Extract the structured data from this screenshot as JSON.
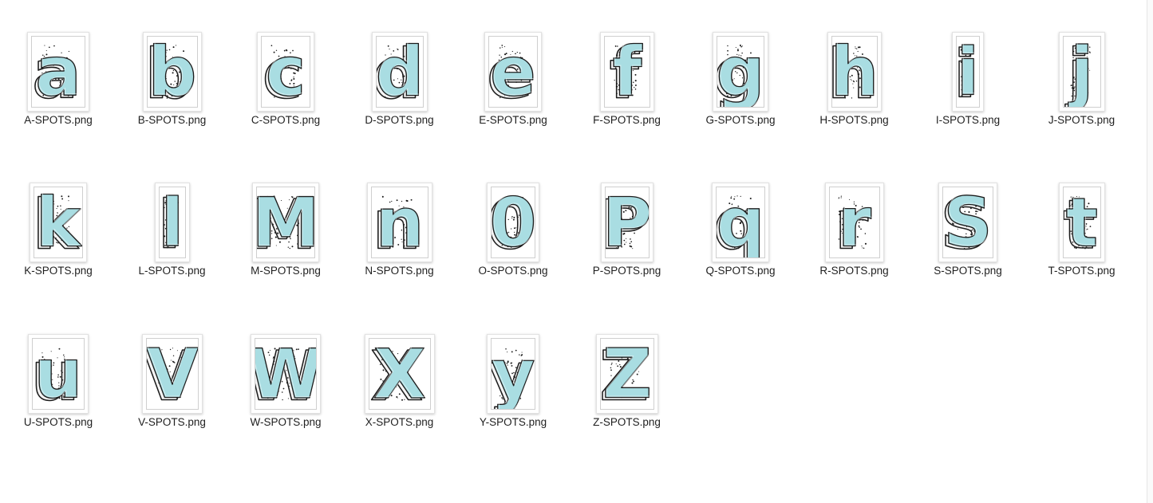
{
  "colors": {
    "letter_fill": "#a9dde2",
    "outline": "#1c1c1c",
    "spots": "#1c1c1c"
  },
  "files": [
    {
      "name": "A-SPOTS.png",
      "glyph": "a",
      "thumb_icon": "letter-a-icon"
    },
    {
      "name": "B-SPOTS.png",
      "glyph": "b",
      "thumb_icon": "letter-b-icon"
    },
    {
      "name": "C-SPOTS.png",
      "glyph": "c",
      "thumb_icon": "letter-c-icon"
    },
    {
      "name": "D-SPOTS.png",
      "glyph": "d",
      "thumb_icon": "letter-d-icon"
    },
    {
      "name": "E-SPOTS.png",
      "glyph": "e",
      "thumb_icon": "letter-e-icon"
    },
    {
      "name": "F-SPOTS.png",
      "glyph": "f",
      "thumb_icon": "letter-f-icon"
    },
    {
      "name": "G-SPOTS.png",
      "glyph": "g",
      "thumb_icon": "letter-g-icon"
    },
    {
      "name": "H-SPOTS.png",
      "glyph": "h",
      "thumb_icon": "letter-h-icon"
    },
    {
      "name": "I-SPOTS.png",
      "glyph": "i",
      "thumb_icon": "letter-i-icon"
    },
    {
      "name": "J-SPOTS.png",
      "glyph": "j",
      "thumb_icon": "letter-j-icon"
    },
    {
      "name": "K-SPOTS.png",
      "glyph": "k",
      "thumb_icon": "letter-k-icon"
    },
    {
      "name": "L-SPOTS.png",
      "glyph": "l",
      "thumb_icon": "letter-l-icon"
    },
    {
      "name": "M-SPOTS.png",
      "glyph": "M",
      "thumb_icon": "letter-m-icon"
    },
    {
      "name": "N-SPOTS.png",
      "glyph": "n",
      "thumb_icon": "letter-n-icon"
    },
    {
      "name": "O-SPOTS.png",
      "glyph": "0",
      "thumb_icon": "letter-o-icon"
    },
    {
      "name": "P-SPOTS.png",
      "glyph": "P",
      "thumb_icon": "letter-p-icon"
    },
    {
      "name": "Q-SPOTS.png",
      "glyph": "q",
      "thumb_icon": "letter-q-icon"
    },
    {
      "name": "R-SPOTS.png",
      "glyph": "r",
      "thumb_icon": "letter-r-icon"
    },
    {
      "name": "S-SPOTS.png",
      "glyph": "S",
      "thumb_icon": "letter-s-icon"
    },
    {
      "name": "T-SPOTS.png",
      "glyph": "t",
      "thumb_icon": "letter-t-icon"
    },
    {
      "name": "U-SPOTS.png",
      "glyph": "u",
      "thumb_icon": "letter-u-icon"
    },
    {
      "name": "V-SPOTS.png",
      "glyph": "V",
      "thumb_icon": "letter-v-icon"
    },
    {
      "name": "W-SPOTS.png",
      "glyph": "W",
      "thumb_icon": "letter-w-icon"
    },
    {
      "name": "X-SPOTS.png",
      "glyph": "X",
      "thumb_icon": "letter-x-icon"
    },
    {
      "name": "Y-SPOTS.png",
      "glyph": "y",
      "thumb_icon": "letter-y-icon"
    },
    {
      "name": "Z-SPOTS.png",
      "glyph": "Z",
      "thumb_icon": "letter-z-icon"
    }
  ]
}
